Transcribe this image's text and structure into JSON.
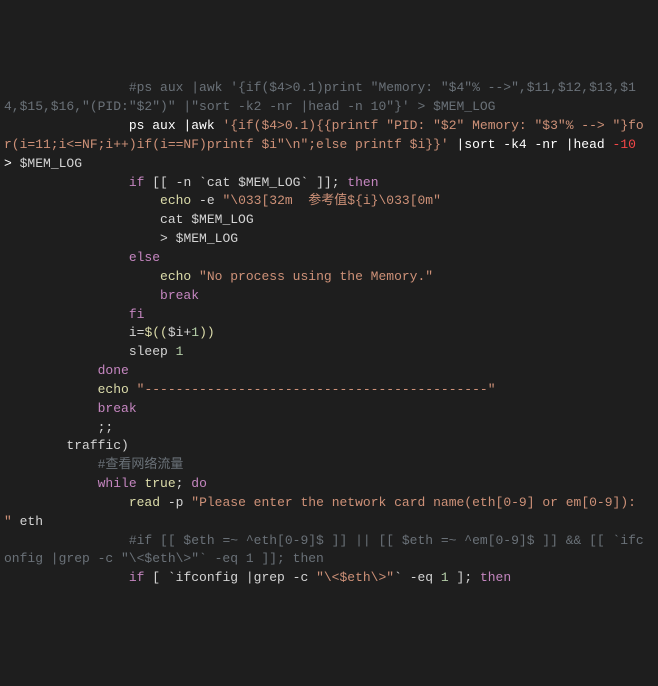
{
  "lines": {
    "l1_comment": "#ps aux |awk '{if($4>0.1)print \"Memory: \"$4\"% -->\",$11,$12,$13,$14,$15,$16,\"(PID:\"$2\")\" |\"sort -k2 -nr |head -n 10\"}' > $MEM_LOG",
    "l2_a": "ps aux ",
    "l2_b": "|awk ",
    "l2_str": "'{if($4>0.1){{printf \"PID: \"$2\" Memory: \"$3\"% --> \"}for(i=11;i<=NF;i++)if(i==NF)printf $i\"\\n\";else printf $i}}'",
    "l2_c": " |sort -k4 -nr |head ",
    "l2_neg": "-10",
    "l2_d": " > ",
    "l2_var": "$MEM_LOG",
    "l3_if": "if",
    "l3_a": " [[ -n `cat ",
    "l3_var": "$MEM_LOG",
    "l3_b": "` ]]; ",
    "l3_then": "then",
    "l4_echo": "echo",
    "l4_a": " -e ",
    "l4_str": "\"\\033[32m  参考值${i}\\033[0m\"",
    "l5_a": "cat ",
    "l5_var": "$MEM_LOG",
    "l6_a": "> ",
    "l6_var": "$MEM_LOG",
    "l7_else": "else",
    "l8_echo": "echo",
    "l8_str": " \"No process using the Memory.\"",
    "l9_break": "break",
    "l10_fi": "fi",
    "l11_a": "i=",
    "l11_b": "$((",
    "l11_c": "$i",
    "l11_d": "+",
    "l11_e": "1",
    "l11_f": "))",
    "l12_a": "sleep ",
    "l12_n": "1",
    "l13_done": "done",
    "l14_echo": "echo",
    "l14_str": " \"--------------------------------------------\"",
    "l15_break": "break",
    "l16_dsemi": ";;",
    "l17_traffic": "traffic)",
    "l18_comment": "#查看网络流量",
    "l19_while": "while",
    "l19_true": " true",
    "l19_sc": "; ",
    "l19_do": "do",
    "l20_read": "read",
    "l20_a": " -p ",
    "l20_str": "\"Please enter the network card name(eth[0-9] or em[0-9]): \"",
    "l20_eth": " eth",
    "l21_comment": "#if [[ $eth =~ ^eth[0-9]$ ]] || [[ $eth =~ ^em[0-9]$ ]] && [[ `ifconfig |grep -c \"\\<$eth\\>\"` -eq 1 ]]; then",
    "l22_if": "if",
    "l22_a": " [ `ifconfig |grep -c ",
    "l22_str": "\"\\<$eth\\>\"",
    "l22_b": "` -eq ",
    "l22_n": "1",
    "l22_c": " ]; ",
    "l22_then": "then"
  },
  "indent": {
    "i0": "",
    "i1": "        ",
    "i2": "            ",
    "i3": "                ",
    "i4": "                    "
  }
}
